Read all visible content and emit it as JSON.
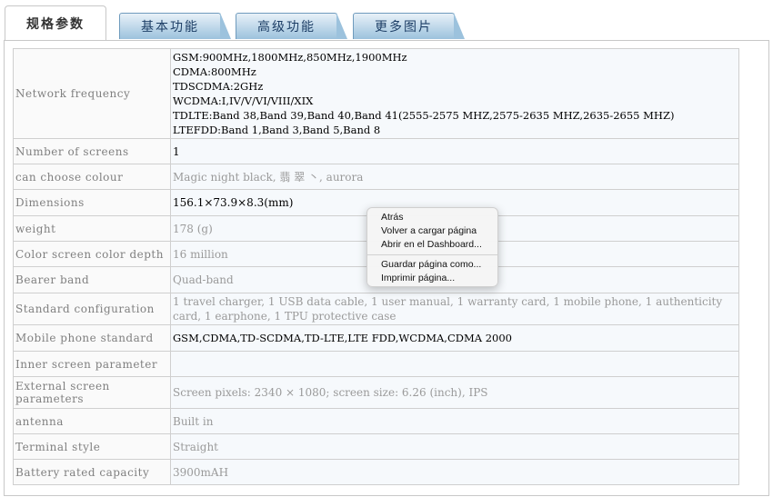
{
  "tabs": {
    "active": "规格参数",
    "items": [
      "基本功能",
      "高级功能",
      "更多图片"
    ]
  },
  "specs": [
    {
      "label": "Network frequency",
      "lines": [
        "GSM:900MHz,1800MHz,850MHz,1900MHz",
        "CDMA:800MHz",
        "TDSCDMA:2GHz",
        "WCDMA:I,IV/V/VI/VIII/XIX",
        "TDLTE:Band 38,Band 39,Band 40,Band 41(2555-2575 MHZ,2575-2635 MHZ,2635-2655 MHZ)",
        "LTEFDD:Band 1,Band 3,Band 5,Band 8"
      ]
    },
    {
      "label": "Number of screens",
      "value": "1"
    },
    {
      "label": "can choose colour",
      "value": "Magic night black, 翡 翠 丶, aurora"
    },
    {
      "label": "Dimensions",
      "value": "156.1×73.9×8.3(mm)"
    },
    {
      "label": "weight",
      "value": "178 (g)"
    },
    {
      "label": "Color screen color depth",
      "value": "16 million"
    },
    {
      "label": "Bearer band",
      "value": "Quad-band"
    },
    {
      "label": "Standard configuration",
      "value": "1 travel charger, 1 USB data cable, 1 user manual, 1 warranty card, 1 mobile phone, 1 authenticity card, 1 earphone, 1 TPU protective case"
    },
    {
      "label": "Mobile phone standard",
      "value": "GSM,CDMA,TD-SCDMA,TD-LTE,LTE FDD,WCDMA,CDMA 2000"
    },
    {
      "label": "Inner screen parameter",
      "value": ""
    },
    {
      "label": "External screen parameters",
      "value": "Screen pixels: 2340 × 1080; screen size: 6.26 (inch), IPS"
    },
    {
      "label": "antenna",
      "value": "Built in"
    },
    {
      "label": "Terminal style",
      "value": "Straight"
    },
    {
      "label": "Battery rated capacity",
      "value": "3900mAH"
    }
  ],
  "context_menu": {
    "group1": [
      "Atrás",
      "Volver a cargar página",
      "Abrir en el Dashboard..."
    ],
    "group2": [
      "Guardar página como...",
      "Imprimir página..."
    ]
  }
}
